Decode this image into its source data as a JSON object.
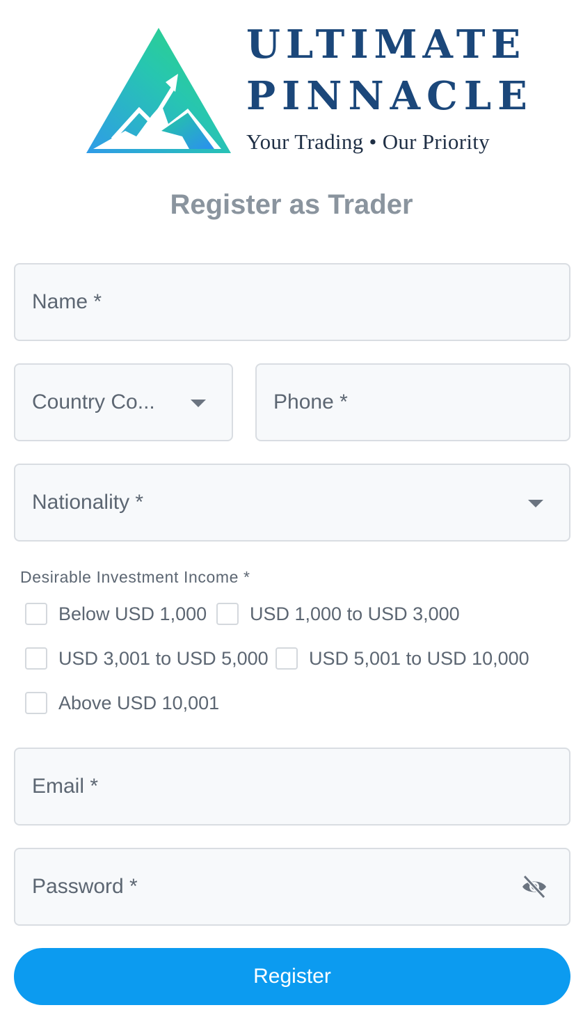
{
  "brand": {
    "line1": "ULTIMATE",
    "line2": "PINNACLE",
    "tagline": "Your Trading • Our Priority"
  },
  "page_title": "Register as Trader",
  "form": {
    "name_label": "Name *",
    "country_code_label": "Country Co...",
    "phone_label": "Phone *",
    "nationality_label": "Nationality *",
    "investment": {
      "title": "Desirable Investment Income *",
      "options": [
        {
          "label": "Below USD 1,000",
          "checked": false
        },
        {
          "label": "USD 1,000 to USD 3,000",
          "checked": false
        },
        {
          "label": "USD 3,001 to USD 5,000",
          "checked": false
        },
        {
          "label": "USD 5,001 to USD 10,000",
          "checked": false
        },
        {
          "label": "Above USD 10,001",
          "checked": false
        }
      ]
    },
    "email_label": "Email *",
    "password_label": "Password *",
    "password_toggle_icon": "eye-off-icon",
    "submit_label": "Register"
  },
  "colors": {
    "brand_navy": "#1b477a",
    "title_gray": "#8a949e",
    "field_bg": "#f7f9fb",
    "field_border": "#d9dde2",
    "button_blue": "#0c9bf0"
  }
}
